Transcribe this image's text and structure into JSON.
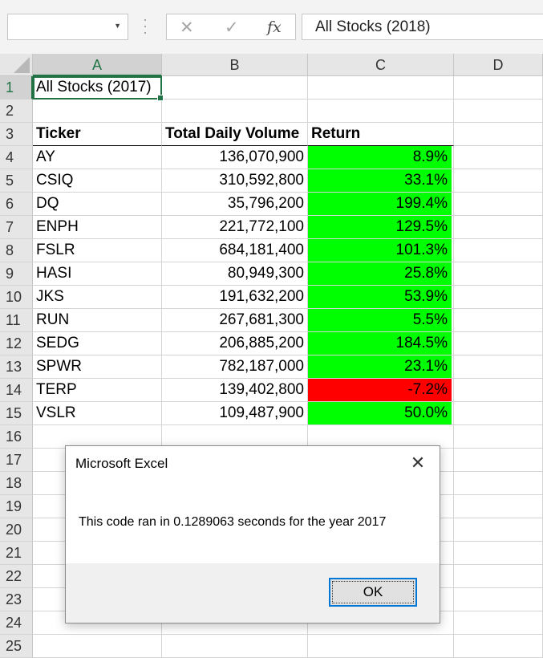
{
  "formula_bar": {
    "name_box_value": "",
    "more_icon": "vertical-ellipsis",
    "cancel_icon": "✕",
    "enter_icon": "✓",
    "function_label": "fx",
    "formula_value": "All Stocks (2018)"
  },
  "columns": [
    "A",
    "B",
    "C",
    "D"
  ],
  "rows": [
    "1",
    "2",
    "3",
    "4",
    "5",
    "6",
    "7",
    "8",
    "9",
    "10",
    "11",
    "12",
    "13",
    "14",
    "15",
    "16",
    "17",
    "18",
    "19",
    "20",
    "21",
    "22",
    "23",
    "24",
    "25"
  ],
  "sheet": {
    "title_cell": "All Stocks (2017)",
    "headers": {
      "ticker": "Ticker",
      "volume": "Total Daily Volume",
      "return": "Return"
    },
    "data": [
      {
        "ticker": "AY",
        "volume": "136,070,900",
        "return": "8.9%",
        "status": "positive"
      },
      {
        "ticker": "CSIQ",
        "volume": "310,592,800",
        "return": "33.1%",
        "status": "positive"
      },
      {
        "ticker": "DQ",
        "volume": "35,796,200",
        "return": "199.4%",
        "status": "positive"
      },
      {
        "ticker": "ENPH",
        "volume": "221,772,100",
        "return": "129.5%",
        "status": "positive"
      },
      {
        "ticker": "FSLR",
        "volume": "684,181,400",
        "return": "101.3%",
        "status": "positive"
      },
      {
        "ticker": "HASI",
        "volume": "80,949,300",
        "return": "25.8%",
        "status": "positive"
      },
      {
        "ticker": "JKS",
        "volume": "191,632,200",
        "return": "53.9%",
        "status": "positive"
      },
      {
        "ticker": "RUN",
        "volume": "267,681,300",
        "return": "5.5%",
        "status": "positive"
      },
      {
        "ticker": "SEDG",
        "volume": "206,885,200",
        "return": "184.5%",
        "status": "positive"
      },
      {
        "ticker": "SPWR",
        "volume": "782,187,000",
        "return": "23.1%",
        "status": "positive"
      },
      {
        "ticker": "TERP",
        "volume": "139,402,800",
        "return": "-7.2%",
        "status": "negative"
      },
      {
        "ticker": "VSLR",
        "volume": "109,487,900",
        "return": "50.0%",
        "status": "positive"
      }
    ],
    "colors": {
      "positive": "#00ff00",
      "negative": "#ff0000",
      "selection": "#217346"
    }
  },
  "dialog": {
    "title": "Microsoft Excel",
    "close_icon": "✕",
    "message": "This code ran in 0.1289063 seconds for the year 2017",
    "ok_label": "OK"
  }
}
